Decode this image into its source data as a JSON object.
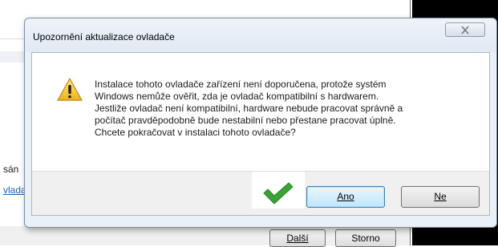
{
  "background": {
    "partial_text_1": "sán",
    "partial_link_1": "vlada",
    "next_button": "Další",
    "cancel_button": "Storno"
  },
  "dialog": {
    "title": "Upozornění aktualizace ovladače",
    "close_icon": "close-x-icon",
    "warning_icon": "warning-triangle-icon",
    "message_lines": [
      "Instalace tohoto ovladače zařízení není doporučena, protože systém",
      "Windows nemůže ověřit, zda je ovladač kompatibilní s hardwarem.",
      "Jestliže ovladač není kompatibilní, hardware nebude pracovat správně a",
      "počítač pravděpodobně bude nestabilní nebo přestane pracovat úplně.",
      "Chcete pokračovat v instalaci tohoto ovladače?"
    ],
    "checkmark_icon": "green-checkmark-icon",
    "yes_button": "Ano",
    "no_button": "Ne"
  },
  "colors": {
    "dialog_bg": "#e9f0f8",
    "checkmark": "#3aa236",
    "warning": "#f2c230"
  }
}
